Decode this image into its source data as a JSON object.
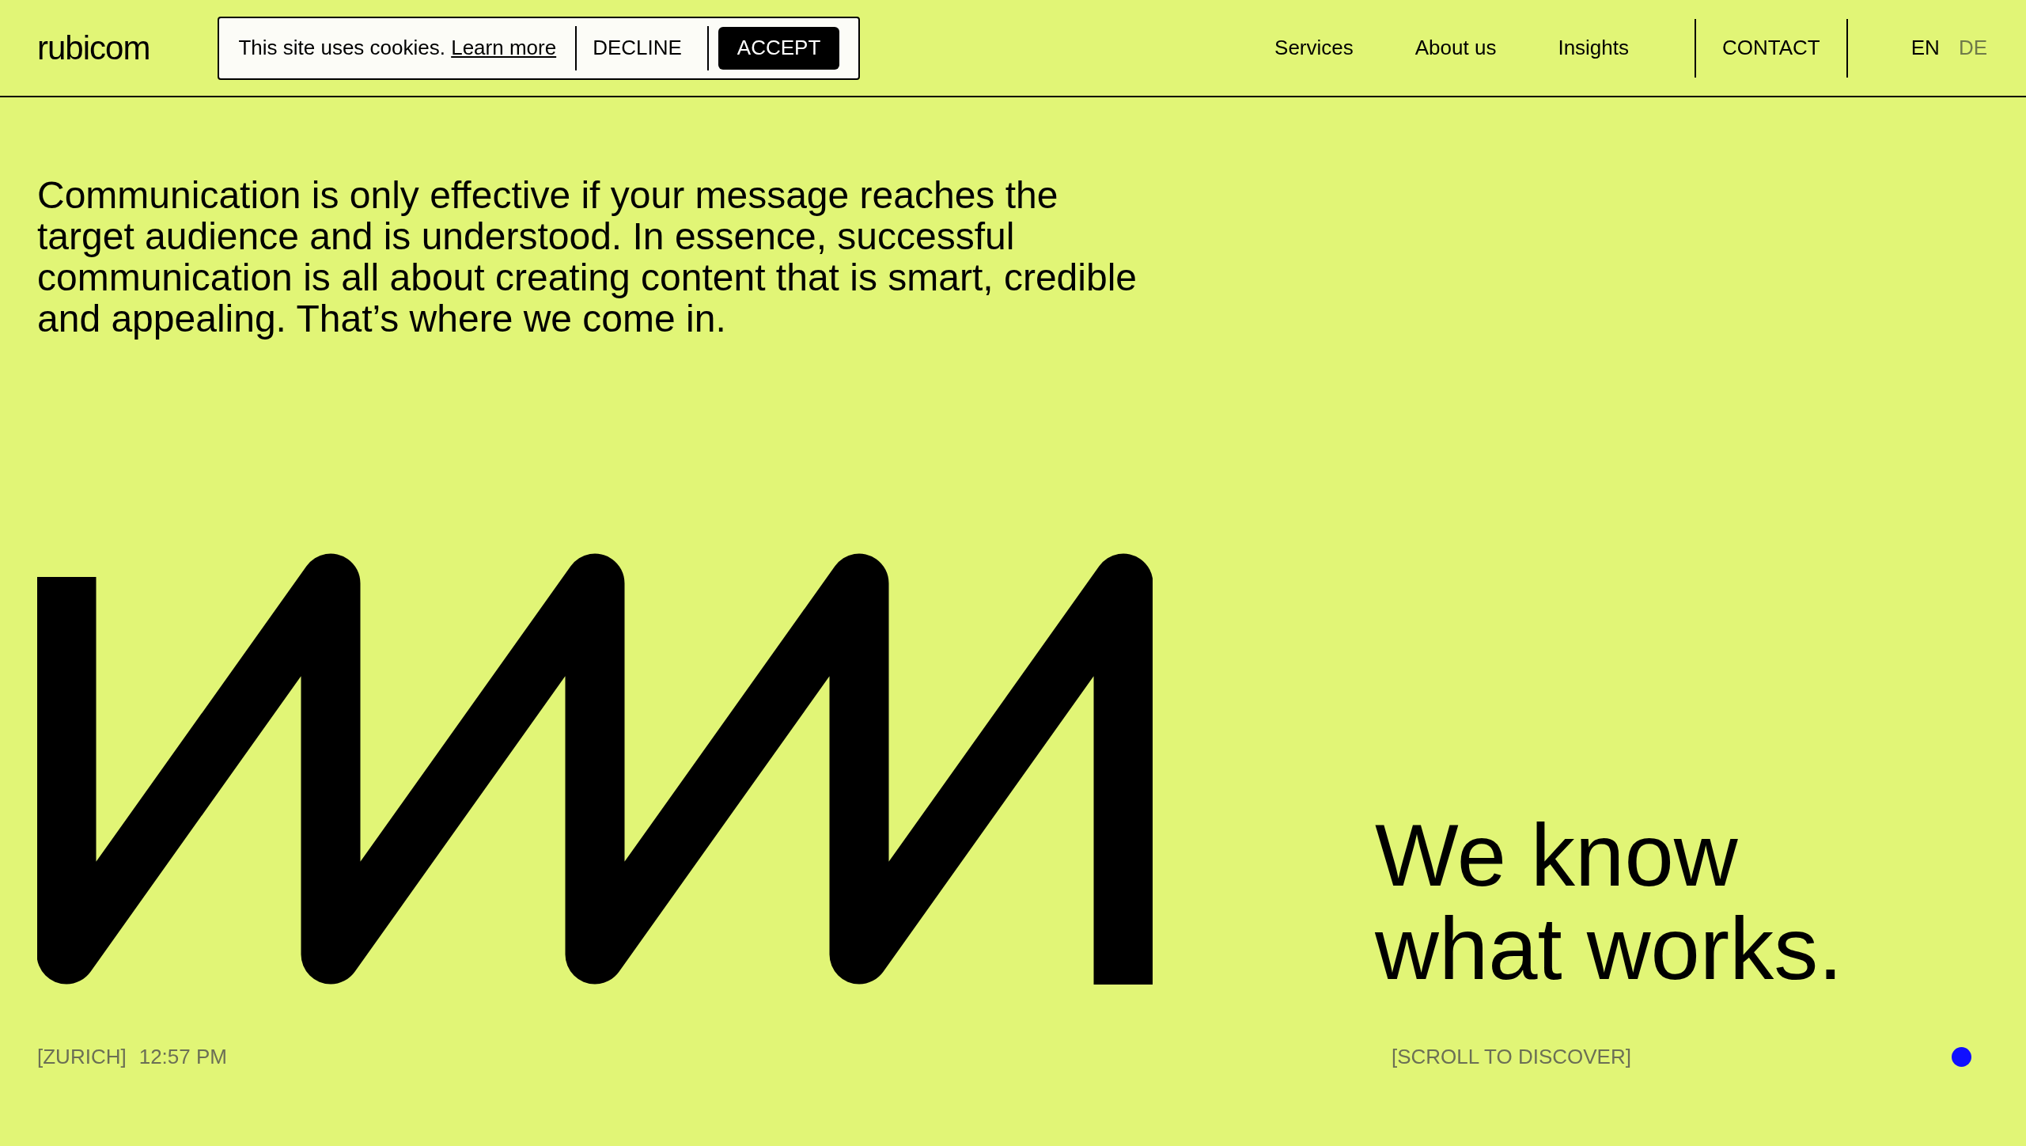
{
  "header": {
    "logo": "rubicom",
    "cookie_banner": {
      "text": "This site uses cookies.",
      "link": "Learn more",
      "buttons": [
        {
          "label": "DECLINE",
          "kind": "secondary"
        },
        {
          "label": "ACCEPT",
          "kind": "primary"
        }
      ]
    },
    "nav": [
      "Services",
      "About us",
      "Insights"
    ],
    "contact": "CONTACT",
    "languages": [
      {
        "label": "EN",
        "selected": true
      },
      {
        "label": "DE",
        "selected": false
      }
    ]
  },
  "intro": "Communication is only effective if your message reaches the target audience and is understood. In essence, successful communication is all about creating content that is smart, credible and appealing. That’s where we come in.",
  "headline": [
    "We know",
    "what works."
  ],
  "footer": {
    "city": "[ZURICH]",
    "time": "12:57 PM",
    "scroll_hint": "[SCROLL TO DISCOVER]"
  }
}
